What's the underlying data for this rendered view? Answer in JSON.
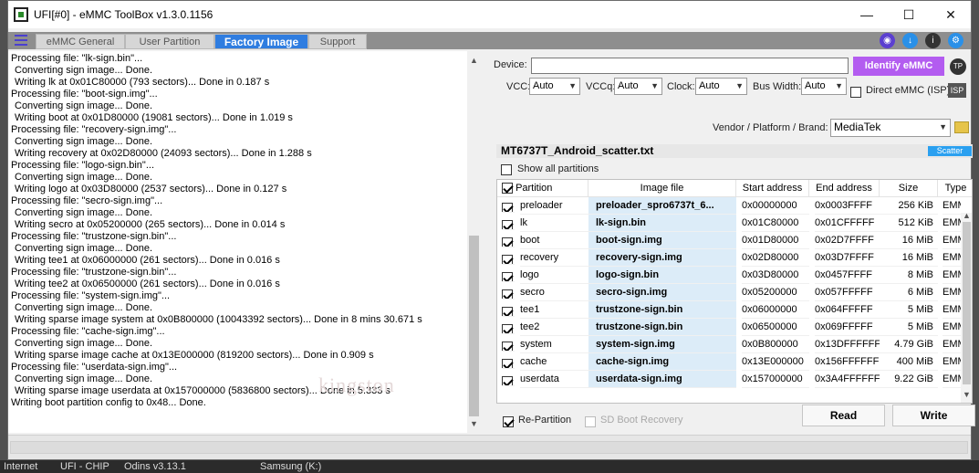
{
  "window": {
    "title": "UFI[#0] - eMMC ToolBox v1.3.0.1156",
    "minimize_glyph": "—",
    "maximize_glyph": "☐",
    "close_glyph": "✕"
  },
  "tabs": [
    {
      "label": "eMMC General"
    },
    {
      "label": "User Partition"
    },
    {
      "label": "Factory Image"
    },
    {
      "label": "Support"
    }
  ],
  "toolbar_icons": [
    "globe-icon",
    "download-icon",
    "info-icon",
    "settings-icon"
  ],
  "log": [
    "Processing file: \"lk-sign.bin\"...",
    "Converting sign image... Done.",
    "Writing lk at 0x01C80000 (793 sectors)... Done in 0.187 s",
    "Processing file: \"boot-sign.img\"...",
    "Converting sign image... Done.",
    "Writing boot at 0x01D80000 (19081 sectors)... Done in 1.019 s",
    "Processing file: \"recovery-sign.img\"...",
    "Converting sign image... Done.",
    "Writing recovery at 0x02D80000 (24093 sectors)... Done in 1.288 s",
    "Processing file: \"logo-sign.bin\"...",
    "Converting sign image... Done.",
    "Writing logo at 0x03D80000 (2537 sectors)... Done in 0.127 s",
    "Processing file: \"secro-sign.img\"...",
    "Converting sign image... Done.",
    "Writing secro at 0x05200000 (265 sectors)... Done in 0.014 s",
    "Processing file: \"trustzone-sign.bin\"...",
    "Converting sign image... Done.",
    "Writing tee1 at 0x06000000 (261 sectors)... Done in 0.016 s",
    "Processing file: \"trustzone-sign.bin\"...",
    "Writing tee2 at 0x06500000 (261 sectors)... Done in 0.016 s",
    "Processing file: \"system-sign.img\"...",
    "Converting sign image... Done.",
    "Writing sparse image system at 0x0B800000 (10043392 sectors)... Done in 8 mins 30.671 s",
    "Processing file: \"cache-sign.img\"...",
    "Converting sign image... Done.",
    "Writing sparse image cache at 0x13E000000 (819200 sectors)... Done in 0.909 s",
    "Processing file: \"userdata-sign.img\"...",
    "Converting sign image... Done.",
    "Writing sparse image userdata at 0x157000000 (5836800 sectors)... Done in 5.333 s",
    "Writing boot partition config to 0x48... Done."
  ],
  "watermark": "kingston",
  "device": {
    "label": "Device:",
    "value": "",
    "identify_label": "Identify eMMC",
    "tp_label": "TP",
    "vcc_label": "VCC:",
    "vcc_value": "Auto",
    "vccq_label": "VCCq:",
    "vccq_value": "Auto",
    "clock_label": "Clock:",
    "clock_value": "Auto",
    "bus_label": "Bus Width:",
    "bus_value": "Auto",
    "direct_label": "Direct eMMC (ISP)",
    "isp_label": "ISP"
  },
  "vendor": {
    "label": "Vendor / Platform / Brand:",
    "value": "MediaTek"
  },
  "scatter": {
    "file": "MT6737T_Android_scatter.txt",
    "tag": "Scatter",
    "show_all_label": "Show all partitions"
  },
  "table": {
    "headers": [
      "Partition",
      "Image file",
      "Start address",
      "End address",
      "Size",
      "Type"
    ],
    "rows": [
      {
        "partition": "preloader",
        "image": "preloader_spro6737t_6...",
        "start": "0x00000000",
        "end": "0x0003FFFF",
        "size": "256 KiB",
        "type": "EMM"
      },
      {
        "partition": "lk",
        "image": "lk-sign.bin",
        "start": "0x01C80000",
        "end": "0x01CFFFFF",
        "size": "512 KiB",
        "type": "EMM"
      },
      {
        "partition": "boot",
        "image": "boot-sign.img",
        "start": "0x01D80000",
        "end": "0x02D7FFFF",
        "size": "16 MiB",
        "type": "EMM"
      },
      {
        "partition": "recovery",
        "image": "recovery-sign.img",
        "start": "0x02D80000",
        "end": "0x03D7FFFF",
        "size": "16 MiB",
        "type": "EMM"
      },
      {
        "partition": "logo",
        "image": "logo-sign.bin",
        "start": "0x03D80000",
        "end": "0x0457FFFF",
        "size": "8 MiB",
        "type": "EMM"
      },
      {
        "partition": "secro",
        "image": "secro-sign.img",
        "start": "0x05200000",
        "end": "0x057FFFFF",
        "size": "6 MiB",
        "type": "EMM"
      },
      {
        "partition": "tee1",
        "image": "trustzone-sign.bin",
        "start": "0x06000000",
        "end": "0x064FFFFF",
        "size": "5 MiB",
        "type": "EMM"
      },
      {
        "partition": "tee2",
        "image": "trustzone-sign.bin",
        "start": "0x06500000",
        "end": "0x069FFFFF",
        "size": "5 MiB",
        "type": "EMM"
      },
      {
        "partition": "system",
        "image": "system-sign.img",
        "start": "0x0B800000",
        "end": "0x13DFFFFFF",
        "size": "4.79 GiB",
        "type": "EMM"
      },
      {
        "partition": "cache",
        "image": "cache-sign.img",
        "start": "0x13E000000",
        "end": "0x156FFFFFF",
        "size": "400 MiB",
        "type": "EMM"
      },
      {
        "partition": "userdata",
        "image": "userdata-sign.img",
        "start": "0x157000000",
        "end": "0x3A4FFFFFF",
        "size": "9.22 GiB",
        "type": "EMM"
      }
    ]
  },
  "bottom": {
    "repartition_label": "Re-Partition",
    "sdboot_label": "SD Boot Recovery",
    "read_label": "Read",
    "write_label": "Write"
  },
  "taskbar": [
    "Internet",
    "UFI - CHIP",
    "Odins v3.13.1",
    "Samsung (K:)"
  ]
}
